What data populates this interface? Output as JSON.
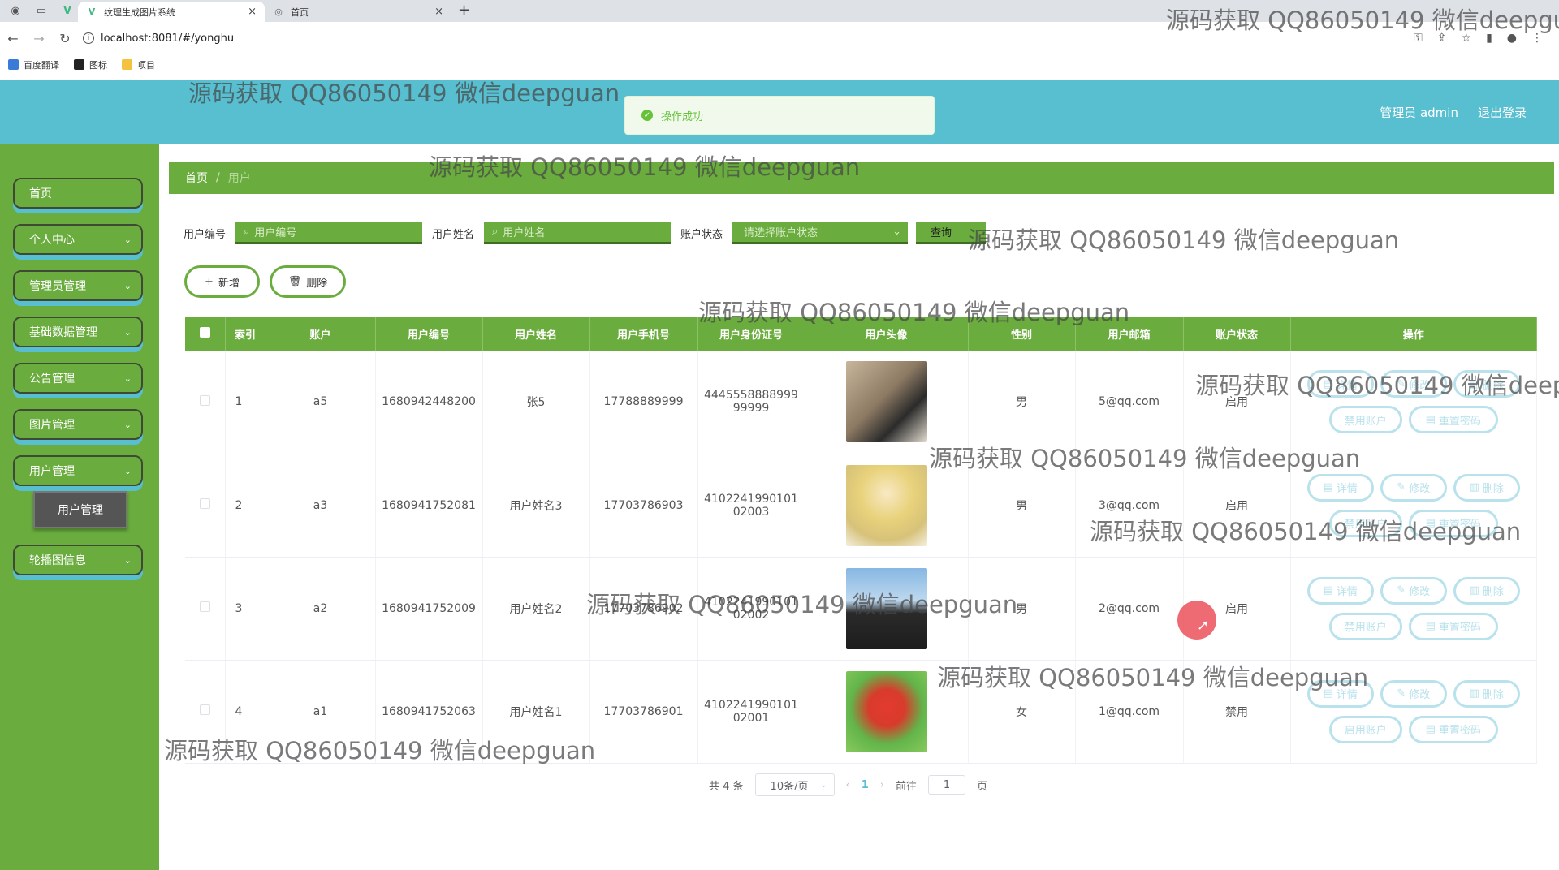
{
  "browser": {
    "tabs": [
      {
        "title": "纹理生成图片系统",
        "active": true
      },
      {
        "title": "首页",
        "active": false
      }
    ],
    "url": "localhost:8081/#/yonghu",
    "bookmarks": [
      "百度翻译",
      "图标",
      "项目"
    ]
  },
  "header": {
    "user": "管理员 admin",
    "logout": "退出登录"
  },
  "toast": {
    "message": "操作成功"
  },
  "sidebar": {
    "items": [
      {
        "label": "首页",
        "chev": ""
      },
      {
        "label": "个人中心",
        "chev": "⌄"
      },
      {
        "label": "管理员管理",
        "chev": "⌄"
      },
      {
        "label": "基础数据管理",
        "chev": "⌄"
      },
      {
        "label": "公告管理",
        "chev": "⌄"
      },
      {
        "label": "图片管理",
        "chev": "⌄"
      },
      {
        "label": "用户管理",
        "chev": "⌄"
      },
      {
        "label": "轮播图信息",
        "chev": "⌄"
      }
    ],
    "submenu": "用户管理"
  },
  "breadcrumb": {
    "home": "首页",
    "sep": "/",
    "current": "用户"
  },
  "search": {
    "code_label": "用户编号",
    "code_placeholder": "用户编号",
    "name_label": "用户姓名",
    "name_placeholder": "用户姓名",
    "status_label": "账户状态",
    "status_placeholder": "请选择账户状态",
    "query": "查询"
  },
  "actions": {
    "add": "新增",
    "delete": "删除"
  },
  "table": {
    "headers": [
      "索引",
      "账户",
      "用户编号",
      "用户姓名",
      "用户手机号",
      "用户身份证号",
      "用户头像",
      "性别",
      "用户邮箱",
      "账户状态",
      "操作"
    ],
    "rows": [
      {
        "index": "1",
        "account": "a5",
        "code": "1680942448200",
        "name": "张5",
        "phone": "17788889999",
        "id1": "4445558888999",
        "id2": "99999",
        "gender": "男",
        "email": "5@qq.com",
        "status": "启用",
        "toggle": "禁用账户"
      },
      {
        "index": "2",
        "account": "a3",
        "code": "1680941752081",
        "name": "用户姓名3",
        "phone": "17703786903",
        "id1": "4102241990101",
        "id2": "02003",
        "gender": "男",
        "email": "3@qq.com",
        "status": "启用",
        "toggle": "禁用账户"
      },
      {
        "index": "3",
        "account": "a2",
        "code": "1680941752009",
        "name": "用户姓名2",
        "phone": "17703786902",
        "id1": "4102241990101",
        "id2": "02002",
        "gender": "男",
        "email": "2@qq.com",
        "status": "启用",
        "toggle": "禁用账户"
      },
      {
        "index": "4",
        "account": "a1",
        "code": "1680941752063",
        "name": "用户姓名1",
        "phone": "17703786901",
        "id1": "4102241990101",
        "id2": "02001",
        "gender": "女",
        "email": "1@qq.com",
        "status": "禁用",
        "toggle": "启用账户"
      }
    ],
    "ops": {
      "detail": "详情",
      "edit": "修改",
      "del": "删除",
      "reset": "重置密码"
    }
  },
  "pagination": {
    "total": "共 4 条",
    "page_size": "10条/页",
    "current": "1",
    "goto_prefix": "前往",
    "goto_value": "1",
    "goto_suffix": "页"
  },
  "watermark": "源码获取 QQ86050149 微信deepguan",
  "colors": {
    "header": "#58bfd1",
    "sidebar": "#6aac3e",
    "accent": "#58bfd1",
    "success": "#67c23a"
  }
}
